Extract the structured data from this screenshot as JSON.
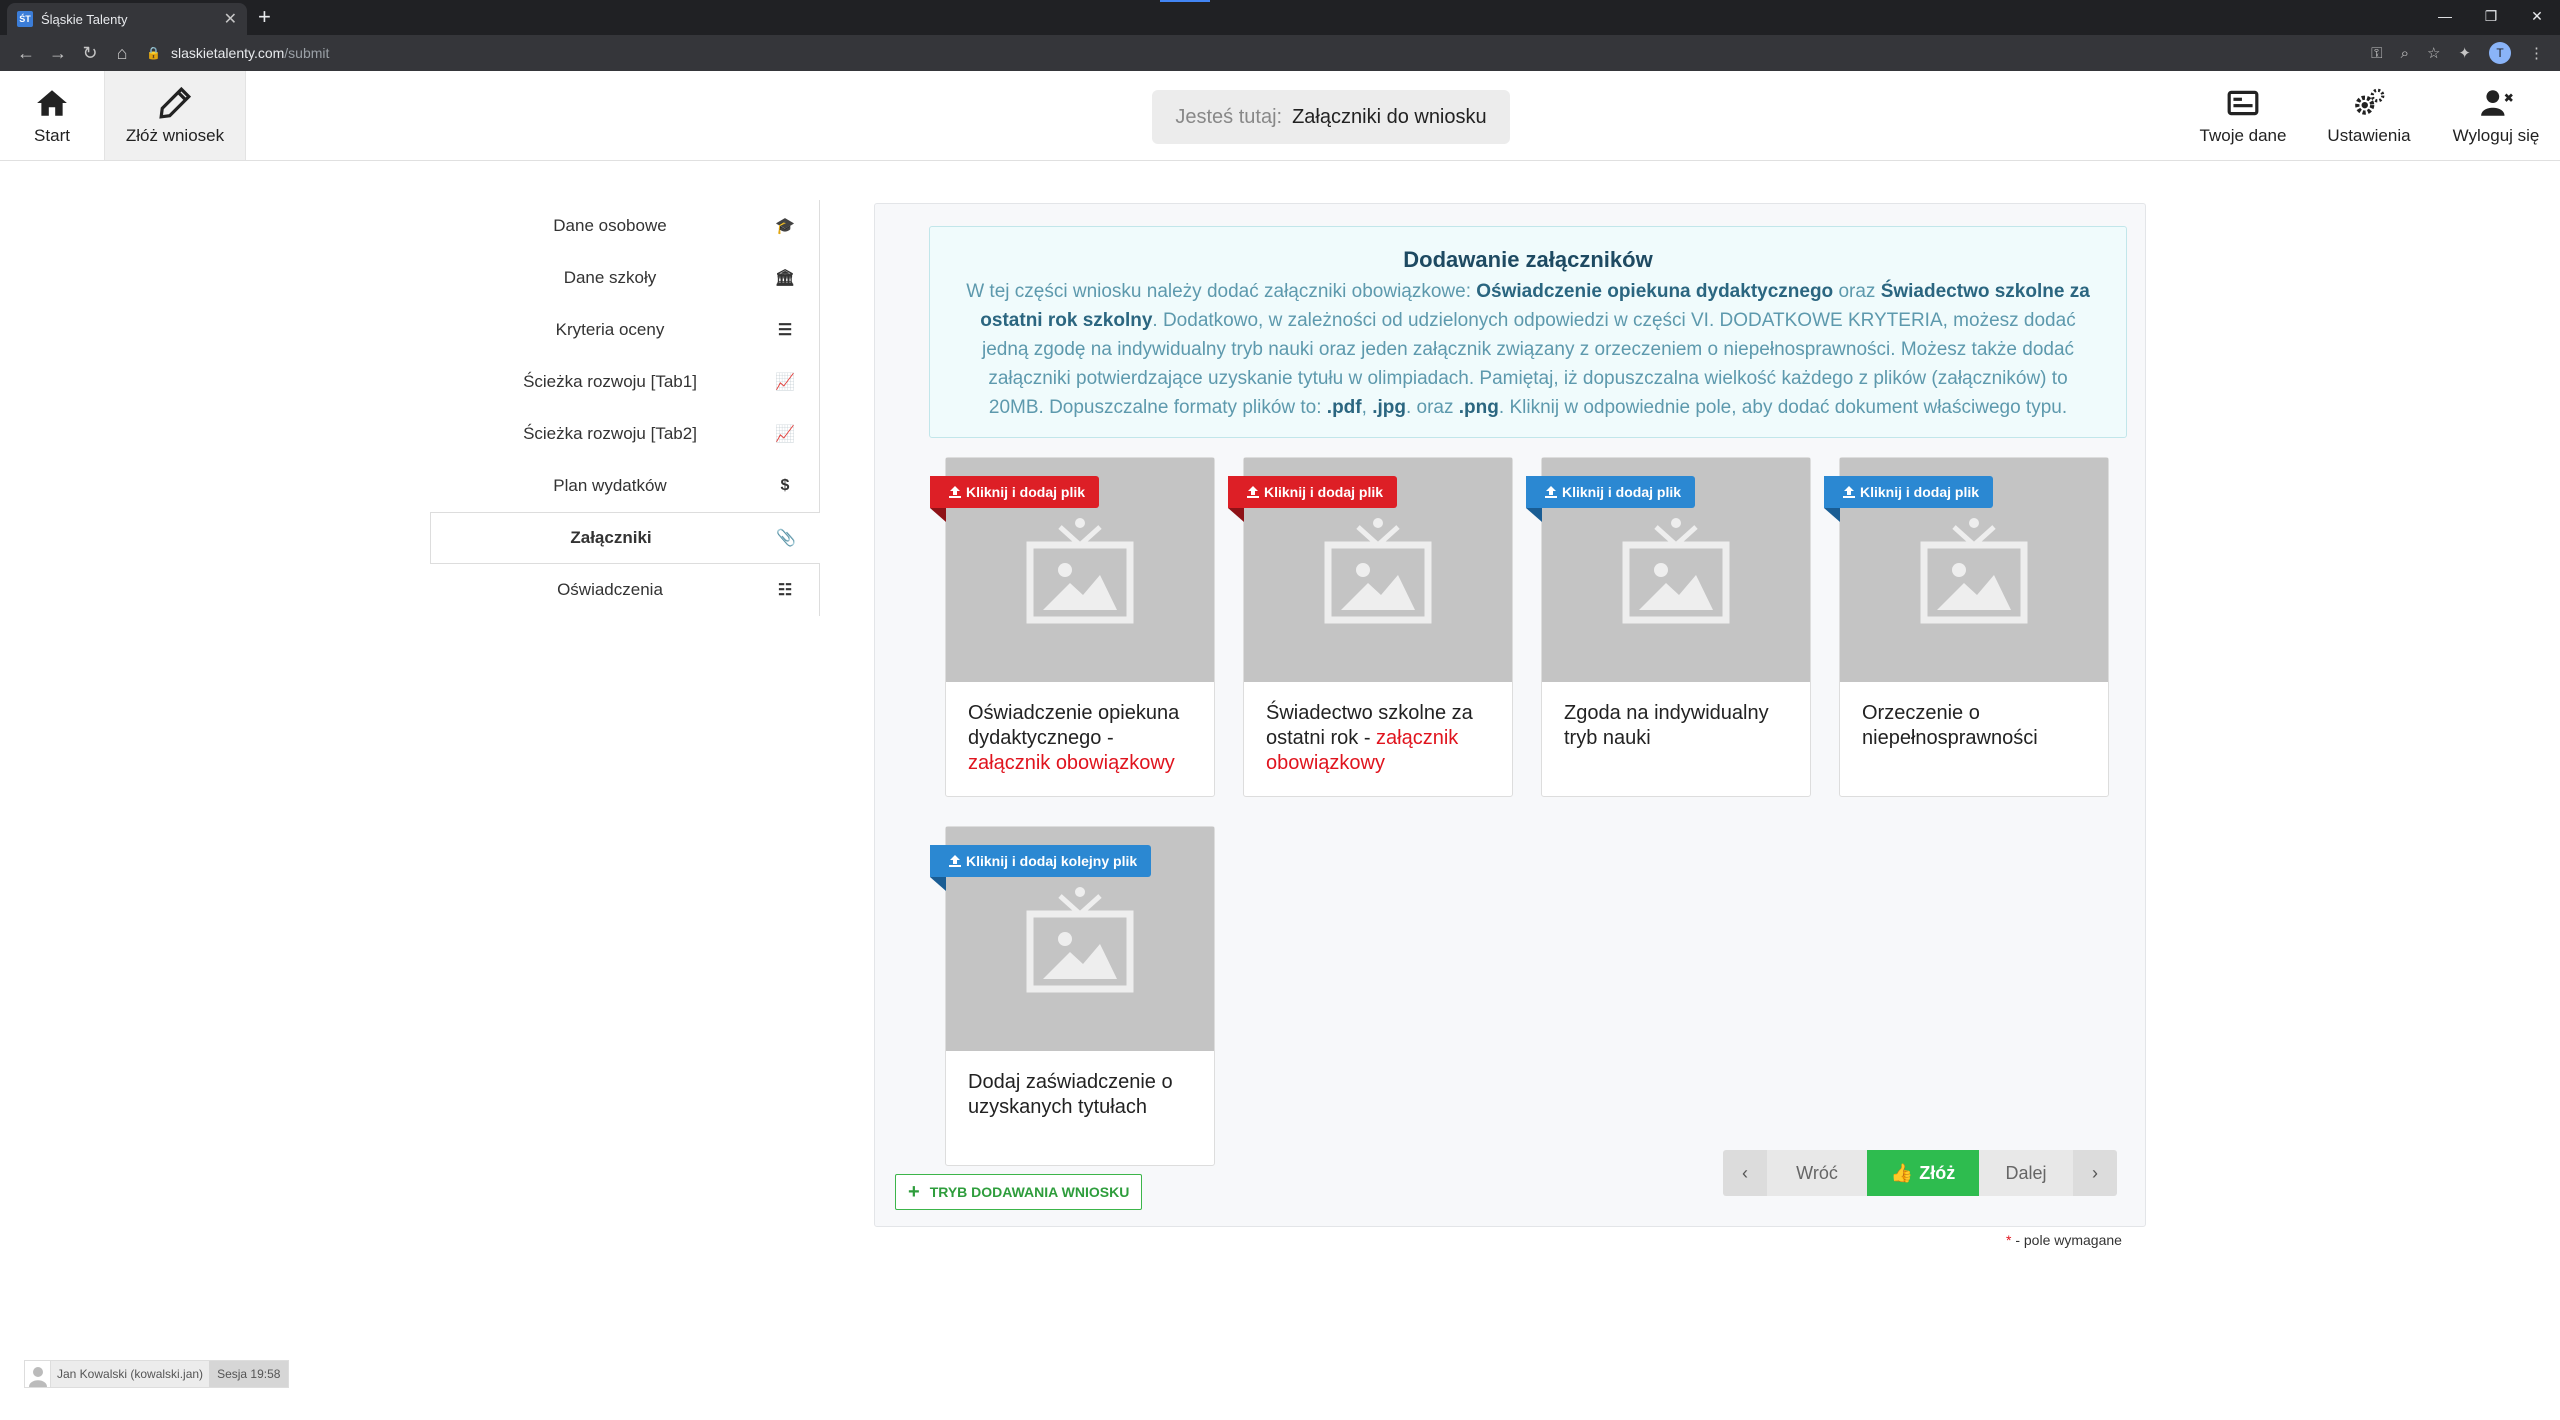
{
  "browser": {
    "tab_title": "Śląskie Talenty",
    "favicon_text": "ŚT",
    "url_host": "slaskietalenty.com",
    "url_path": "/submit",
    "profile_initial": "T"
  },
  "appbar": {
    "start": "Start",
    "submit_app": "Złóż wniosek",
    "here_label": "Jesteś tutaj:",
    "here_value": "Załączniki do wniosku",
    "your_data": "Twoje dane",
    "settings": "Ustawienia",
    "logout": "Wyloguj się"
  },
  "sidebar": {
    "items": [
      {
        "label": "Dane osobowe",
        "icon": "graduation-cap-icon"
      },
      {
        "label": "Dane szkoły",
        "icon": "institution-icon"
      },
      {
        "label": "Kryteria oceny",
        "icon": "sliders-icon"
      },
      {
        "label": "Ścieżka rozwoju [Tab1]",
        "icon": "line-chart-icon"
      },
      {
        "label": "Ścieżka rozwoju [Tab2]",
        "icon": "line-chart-icon"
      },
      {
        "label": "Plan wydatków",
        "icon": "dollar-icon"
      },
      {
        "label": "Załączniki",
        "icon": "paperclip-icon"
      },
      {
        "label": "Oświadczenia",
        "icon": "checklist-icon"
      }
    ],
    "active_index": 6
  },
  "info": {
    "title": "Dodawanie załączników",
    "p1": "W tej części wniosku należy dodać załączniki obowiązkowe: ",
    "b1": "Oświadczenie opiekuna dydaktycznego",
    "p2": " oraz ",
    "b2": "Świadectwo szkolne za ostatni rok szkolny",
    "p3": ". Dodatkowo, w zależności od udzielonych odpowiedzi w części VI. DODATKOWE KRYTERIA, możesz dodać jedną zgodę na indywidualny tryb nauki oraz jeden załącznik związany z orzeczeniem o niepełnosprawności. Możesz także dodać załączniki potwierdzające uzyskanie tytułu w olimpiadach. Pamiętaj, iż dopuszczalna wielkość każdego z plików (załączników) to 20MB. Dopuszczalne formaty plików to: ",
    "b3": ".pdf",
    "p4": ", ",
    "b4": ".jpg",
    "p5": ". oraz ",
    "b5": ".png",
    "p6": ". Kliknij w odpowiednie pole, aby dodać dokument właściwego typu."
  },
  "cards": [
    {
      "ribbon": "Kliknij i dodaj plik",
      "ribbon_color": "#dd1f26",
      "title": "Oświadczenie opiekuna dydaktycznego - ",
      "required": "załącznik obowiązkowy"
    },
    {
      "ribbon": "Kliknij i dodaj plik",
      "ribbon_color": "#dd1f26",
      "title": "Świadectwo szkolne za ostatni rok - ",
      "required": "załącznik obowiązkowy"
    },
    {
      "ribbon": "Kliknij i dodaj plik",
      "ribbon_color": "#2b88d2",
      "title": "Zgoda na indywidualny tryb nauki",
      "required": ""
    },
    {
      "ribbon": "Kliknij i dodaj plik",
      "ribbon_color": "#2b88d2",
      "title": "Orzeczenie o niepełnosprawności",
      "required": ""
    },
    {
      "ribbon": "Kliknij i dodaj kolejny plik",
      "ribbon_color": "#2b88d2",
      "title": "Dodaj zaświadczenie o uzyskanych tytułach",
      "required": ""
    }
  ],
  "actions": {
    "mode_button": "TRYB DODAWANIA WNIOSKU",
    "back": "Wróć",
    "submit": "Złóż",
    "next": "Dalej"
  },
  "footer": {
    "required_star": "*",
    "required_note": " - pole wymagane",
    "user": "Jan Kowalski (kowalski.jan)",
    "session": "Sesja 19:58"
  }
}
